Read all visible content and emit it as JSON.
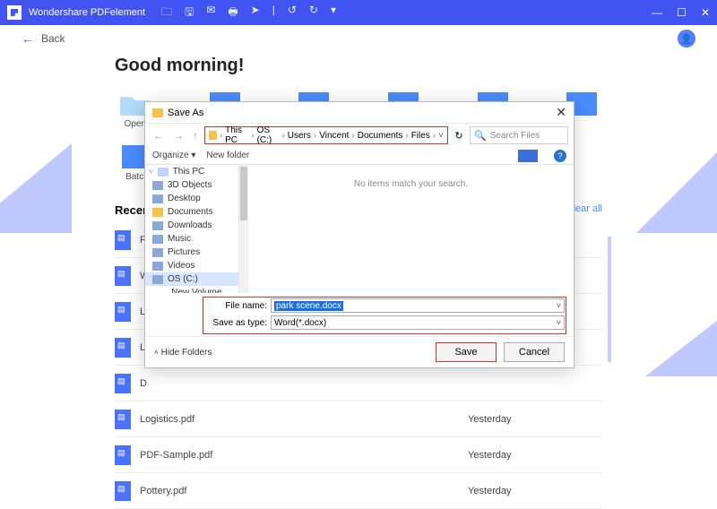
{
  "titlebar": {
    "app_name": "Wondershare PDFelement"
  },
  "topbar": {
    "back_label": "Back"
  },
  "greeting": "Good morning!",
  "tiles": [
    {
      "label": "Open"
    },
    {
      "label": " "
    },
    {
      "label": " "
    },
    {
      "label": " "
    },
    {
      "label": " "
    },
    {
      "label": " "
    }
  ],
  "tile_batch": {
    "label": "Batch"
  },
  "recent": {
    "heading": "Recent",
    "clear": "Clear all",
    "items": [
      {
        "name": "F",
        "when": ""
      },
      {
        "name": "W",
        "when": ""
      },
      {
        "name": "L",
        "when": ""
      },
      {
        "name": "L",
        "when": ""
      },
      {
        "name": "D",
        "when": ""
      },
      {
        "name": "Logistics.pdf",
        "when": "Yesterday"
      },
      {
        "name": "PDF-Sample.pdf",
        "when": "Yesterday"
      },
      {
        "name": "Pottery.pdf",
        "when": "Yesterday"
      }
    ]
  },
  "dialog": {
    "title": "Save As",
    "breadcrumb": [
      "This PC",
      "OS (C:)",
      "Users",
      "Vincent",
      "Documents",
      "Files"
    ],
    "refresh": "↻",
    "search_placeholder": "Search Files",
    "organize": "Organize ▾",
    "newfolder": "New folder",
    "help": "?",
    "tree": [
      {
        "label": "This PC",
        "cls": "pc",
        "arr": "˅"
      },
      {
        "label": "3D Objects",
        "cls": "dr"
      },
      {
        "label": "Desktop",
        "cls": "dr"
      },
      {
        "label": "Documents",
        "cls": "fo"
      },
      {
        "label": "Downloads",
        "cls": "dr"
      },
      {
        "label": "Music",
        "cls": "dr"
      },
      {
        "label": "Pictures",
        "cls": "dr"
      },
      {
        "label": "Videos",
        "cls": "dr"
      },
      {
        "label": "OS (C:)",
        "cls": "dr",
        "sel": true
      },
      {
        "label": "New Volume (D:)",
        "cls": "dr",
        "arr": "˅"
      }
    ],
    "empty_msg": "No items match your search.",
    "filename_label": "File name:",
    "filename_value": "park scene.docx",
    "type_label": "Save as type:",
    "type_value": "Word(*.docx)",
    "hide": "Hide Folders",
    "save_btn": "Save",
    "cancel_btn": "Cancel"
  }
}
